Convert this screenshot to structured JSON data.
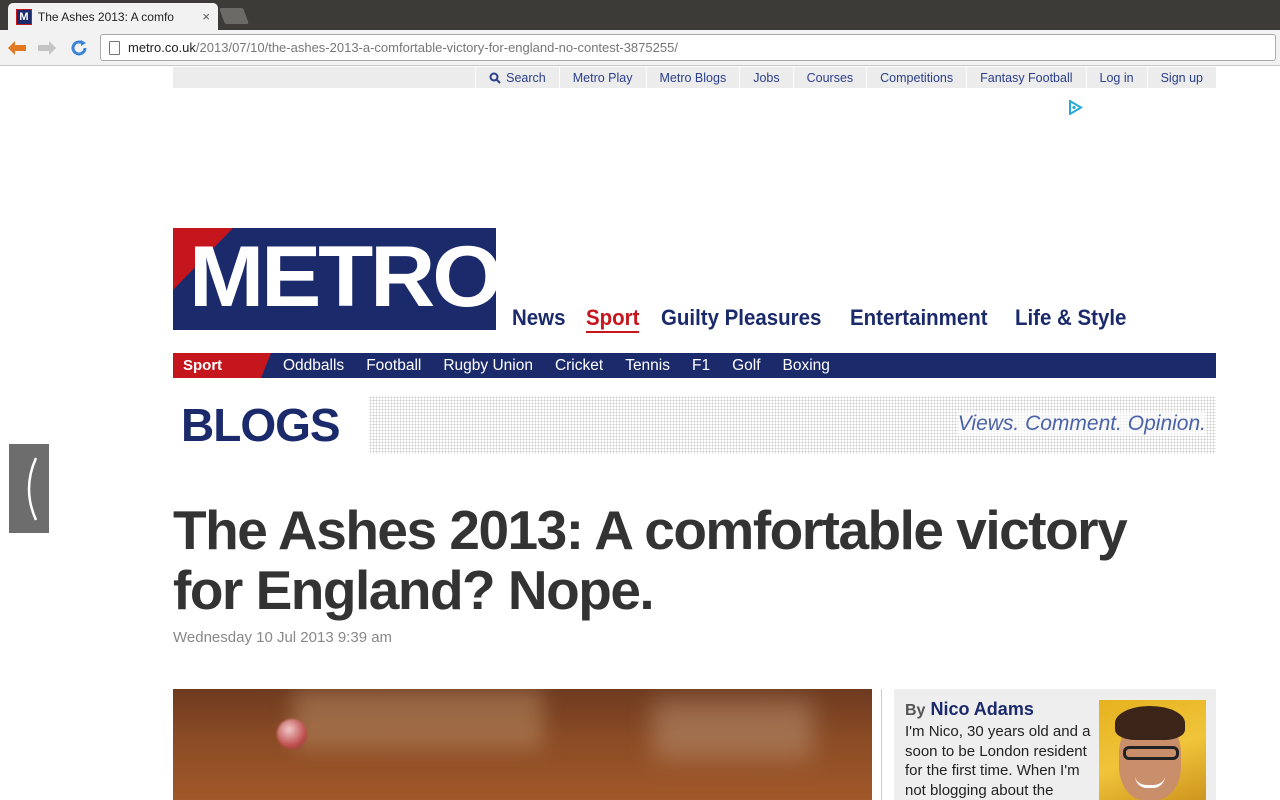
{
  "browser": {
    "tab_title": "The Ashes 2013: A comfo",
    "tab_favicon_letter": "M",
    "tab_close": "×",
    "url_host": "metro.co.uk",
    "url_path": "/2013/07/10/the-ashes-2013-a-comfortable-victory-for-england-no-contest-3875255/"
  },
  "utility_nav": {
    "items": [
      "Search",
      "Metro Play",
      "Metro Blogs",
      "Jobs",
      "Courses",
      "Competitions",
      "Fantasy Football",
      "Log in",
      "Sign up"
    ]
  },
  "logo": {
    "text": "METRO"
  },
  "main_nav": {
    "items": [
      "News",
      "Sport",
      "Guilty Pleasures",
      "Entertainment",
      "Life & Style"
    ],
    "active": "Sport"
  },
  "sub_nav": {
    "section": "Sport",
    "items": [
      "Oddballs",
      "Football",
      "Rugby Union",
      "Cricket",
      "Tennis",
      "F1",
      "Golf",
      "Boxing"
    ]
  },
  "blogs": {
    "title": "BLOGS",
    "tagline": "Views. Comment. Opinion."
  },
  "article": {
    "headline": "The Ashes 2013: A comfortable victory for England? Nope.",
    "date": "Wednesday 10 Jul 2013 9:39 am"
  },
  "author": {
    "by": "By",
    "name": "Nico Adams",
    "bio": "I'm Nico, 30 years old and a soon to be London resident for the first time. When I'm not blogging about the"
  },
  "colors": {
    "brand_navy": "#1b2a6b",
    "brand_red": "#c4161c"
  }
}
